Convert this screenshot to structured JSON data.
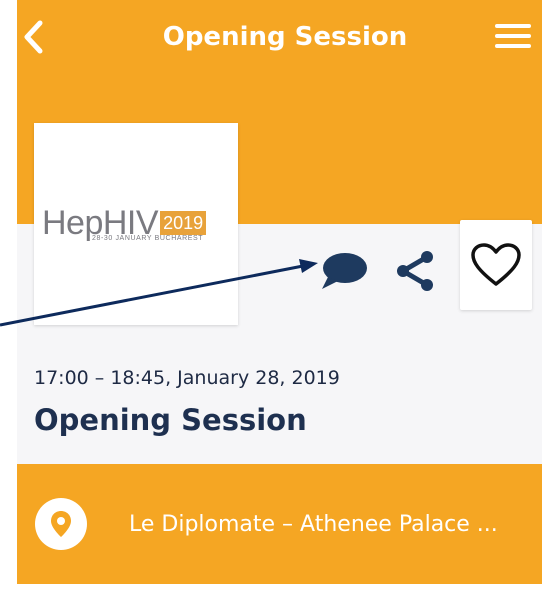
{
  "header": {
    "title": "Opening Session",
    "back_icon": "back-chevron-icon",
    "menu_icon": "hamburger-menu-icon"
  },
  "logo": {
    "brand": "HepHIV",
    "year": "2019",
    "subtitle": "28-30 JANUARY BUCHAREST"
  },
  "actions": {
    "chat_icon": "chat-bubble-icon",
    "share_icon": "share-icon",
    "favorite_icon": "heart-outline-icon"
  },
  "session": {
    "time": "17:00 – 18:45, January 28, 2019",
    "title": "Opening Session"
  },
  "location": {
    "icon": "map-pin-icon",
    "text": "Le Diplomate – Athenee Palace ..."
  },
  "colors": {
    "accent": "#f5a623",
    "navy": "#1e3050",
    "annotation_arrow": "#0d2a5c"
  }
}
